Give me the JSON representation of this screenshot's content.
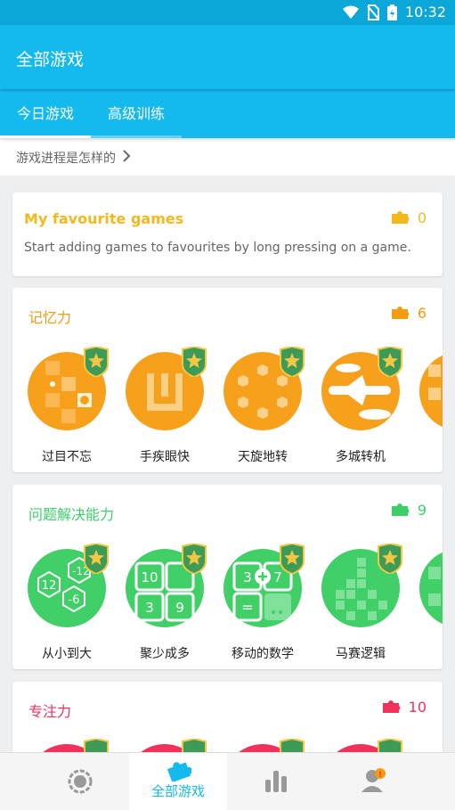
{
  "status_bar": {
    "time": "10:32"
  },
  "app_bar": {
    "title": "全部游戏"
  },
  "tabs": [
    {
      "label": "今日游戏",
      "active": true
    },
    {
      "label": "高级训练",
      "active": false
    }
  ],
  "progress_link": {
    "label": "游戏进程是怎样的"
  },
  "favourites": {
    "title": "My favourite games",
    "count": "0",
    "description": "Start adding games to favourites by long pressing on a game.",
    "color": "#f4b91f"
  },
  "categories": [
    {
      "title": "记忆力",
      "count": "6",
      "color": "#f39c12",
      "games": [
        {
          "name": "过目不忘"
        },
        {
          "name": "手疾眼快"
        },
        {
          "name": "天旋地转"
        },
        {
          "name": "多城转机"
        }
      ]
    },
    {
      "title": "问题解决能力",
      "count": "9",
      "color": "#3ecf6a",
      "games": [
        {
          "name": "从小到大"
        },
        {
          "name": "聚少成多"
        },
        {
          "name": "移动的数学"
        },
        {
          "name": "马赛逻辑"
        }
      ],
      "tile_texts": [
        "12",
        "-6",
        "-12",
        "10",
        "3",
        "9",
        "3",
        "7"
      ]
    },
    {
      "title": "专注力",
      "count": "10",
      "color": "#f0325a",
      "games": []
    }
  ],
  "bottom_nav": {
    "active_label": "全部游戏",
    "items": [
      "overview-icon",
      "puzzle-icon",
      "stats-icon",
      "profile-icon"
    ]
  }
}
